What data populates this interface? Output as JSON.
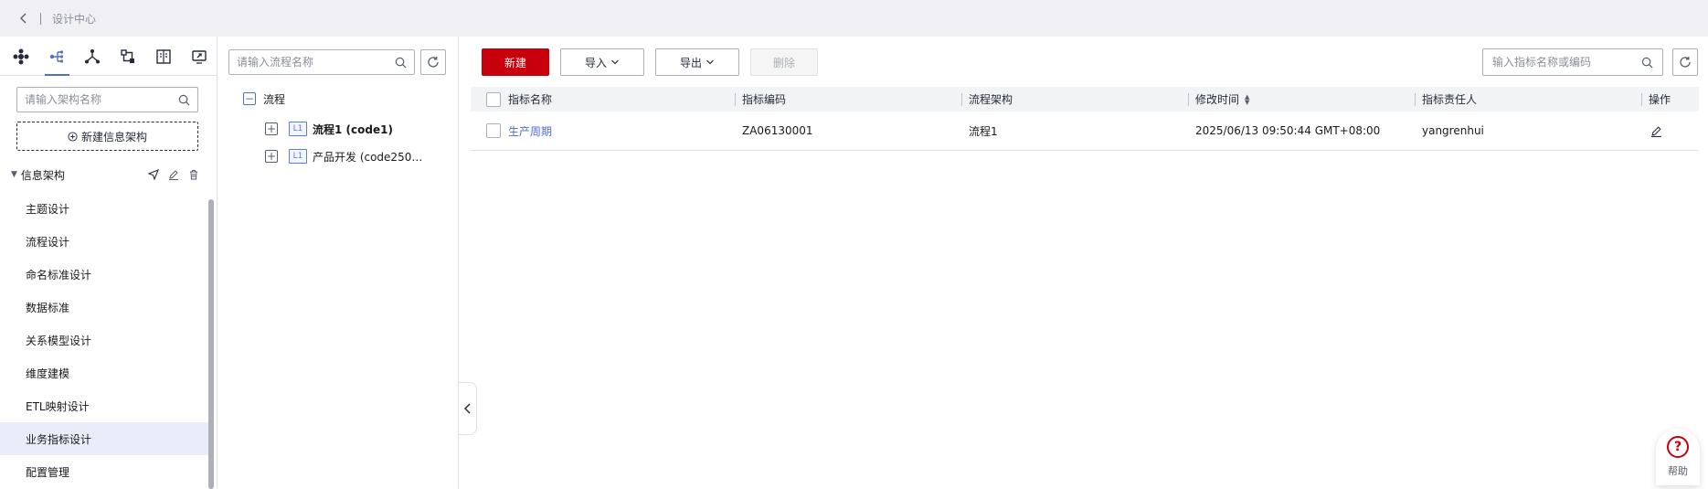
{
  "topbar": {
    "breadcrumb": "设计中心"
  },
  "leftnav": {
    "tabs": [
      {
        "icon": "module-grid-icon"
      },
      {
        "icon": "process-tree-icon",
        "active": true
      },
      {
        "icon": "hierarchy-icon"
      },
      {
        "icon": "flow-icon"
      },
      {
        "icon": "book-icon"
      },
      {
        "icon": "monitor-icon"
      }
    ],
    "search_placeholder": "请输入架构名称",
    "new_arch_label": "新建信息架构",
    "group_title": "信息架构",
    "items": [
      {
        "label": "主题设计"
      },
      {
        "label": "流程设计"
      },
      {
        "label": "命名标准设计"
      },
      {
        "label": "数据标准"
      },
      {
        "label": "关系模型设计"
      },
      {
        "label": "维度建模"
      },
      {
        "label": "ETL映射设计"
      },
      {
        "label": "业务指标设计",
        "active": true
      },
      {
        "label": "配置管理"
      }
    ]
  },
  "tree": {
    "search_placeholder": "请输入流程名称",
    "root_label": "流程",
    "nodes": [
      {
        "level": "L1",
        "label": "流程1 (code1)",
        "selected": true
      },
      {
        "level": "L1",
        "label": "产品开发 (code2506..."
      }
    ]
  },
  "toolbar": {
    "new_label": "新建",
    "import_label": "导入",
    "export_label": "导出",
    "delete_label": "删除",
    "search_placeholder": "输入指标名称或编码"
  },
  "table": {
    "columns": [
      "指标名称",
      "指标编码",
      "流程架构",
      "修改时间",
      "指标责任人",
      "操作"
    ],
    "rows": [
      {
        "name": "生产周期",
        "code": "ZA06130001",
        "arch": "流程1",
        "modified": "2025/06/13 09:50:44 GMT+08:00",
        "owner": "yangrenhui"
      }
    ]
  },
  "help": {
    "label": "帮助"
  },
  "colors": {
    "primary": "#c7000b",
    "accent": "#526ecc",
    "selected_bg": "#e9edfa"
  }
}
